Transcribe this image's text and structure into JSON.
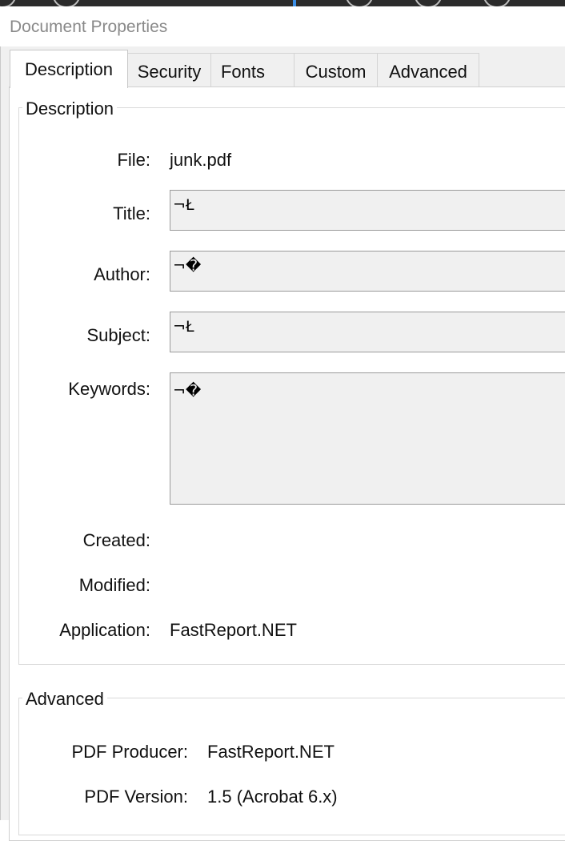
{
  "window": {
    "title": "Document Properties"
  },
  "tabs": [
    {
      "label": "Description"
    },
    {
      "label": "Security"
    },
    {
      "label": "Fonts"
    },
    {
      "label": "Custom"
    },
    {
      "label": "Advanced"
    }
  ],
  "description": {
    "legend": "Description",
    "file_label": "File:",
    "file_value": "junk.pdf",
    "title_label": "Title:",
    "title_value": "¬Ł",
    "author_label": "Author:",
    "author_value": "¬�",
    "subject_label": "Subject:",
    "subject_value": "¬Ł",
    "keywords_label": "Keywords:",
    "keywords_value": "¬�",
    "created_label": "Created:",
    "created_value": "",
    "modified_label": "Modified:",
    "modified_value": "",
    "application_label": "Application:",
    "application_value": "FastReport.NET"
  },
  "advanced": {
    "legend": "Advanced",
    "producer_label": "PDF Producer:",
    "producer_value": "FastReport.NET",
    "version_label": "PDF Version:",
    "version_value": "1.5 (Acrobat 6.x)"
  }
}
